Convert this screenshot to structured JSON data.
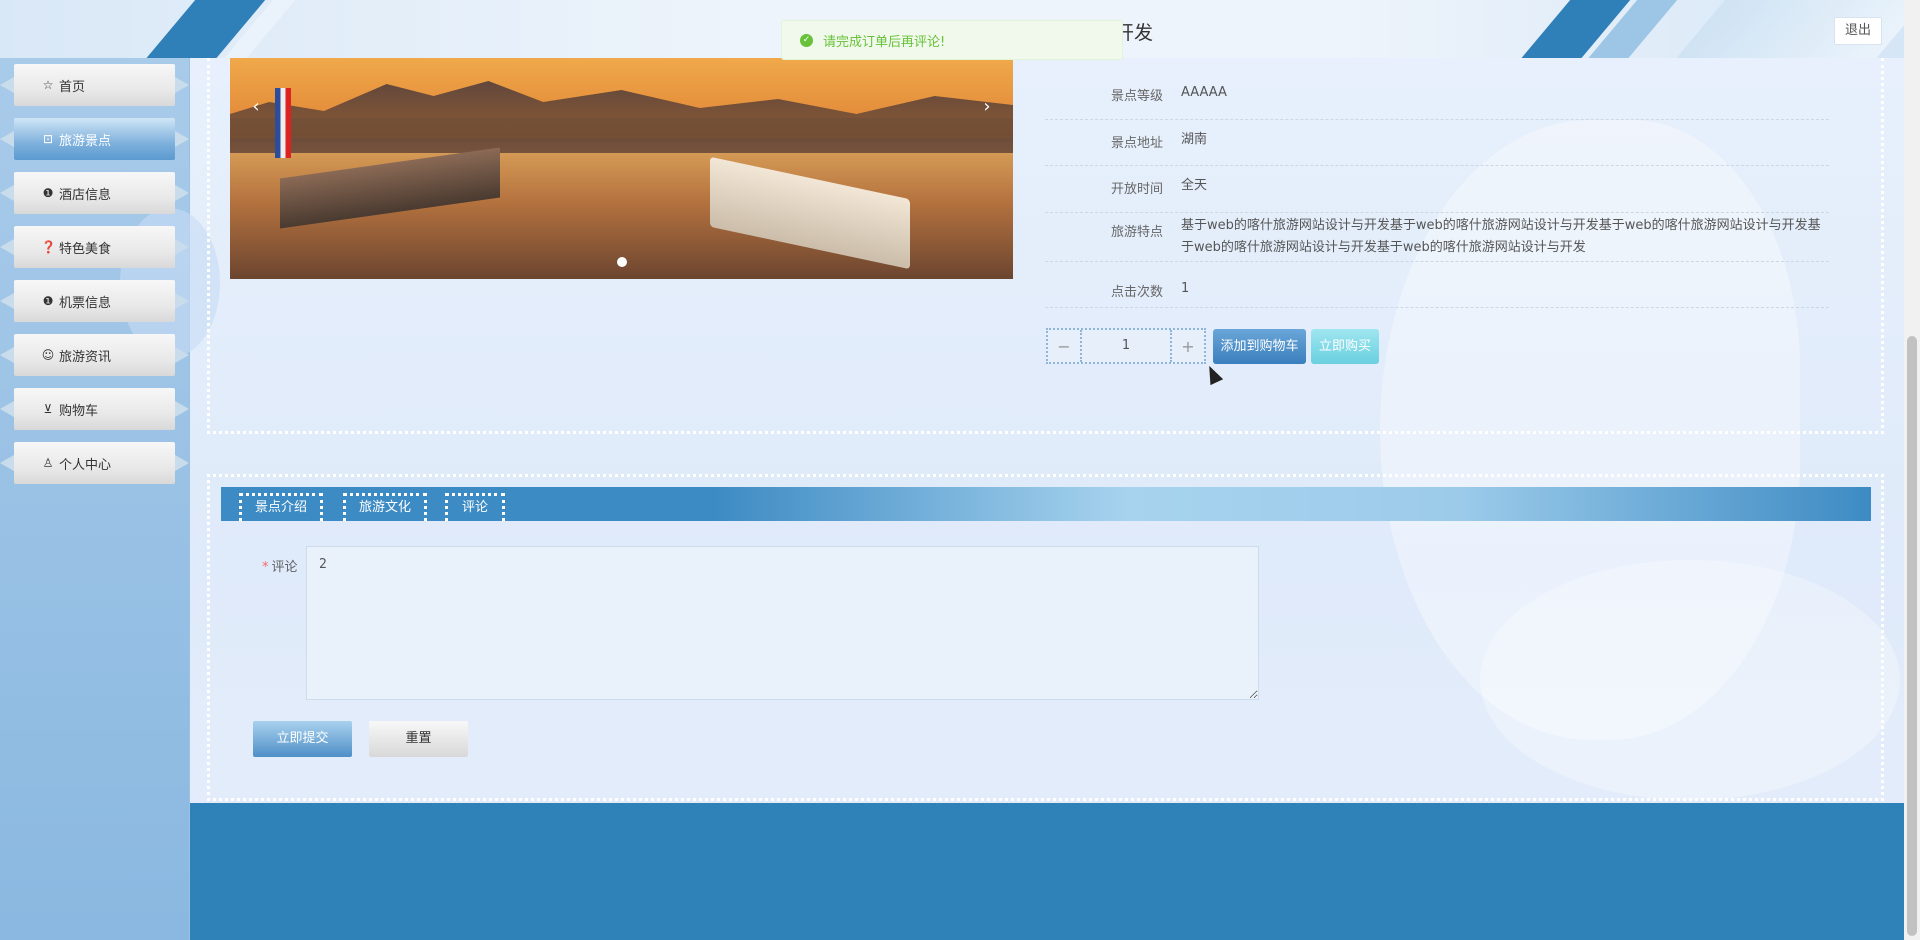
{
  "header": {
    "title": "开发",
    "logout_label": "退出"
  },
  "toast": {
    "message": "请完成订单后再评论!",
    "icon": "check-circle-icon",
    "color": "#67c23a"
  },
  "sidebar": {
    "items": [
      {
        "label": "首页",
        "icon": "star-icon",
        "active": false
      },
      {
        "label": "旅游景点",
        "icon": "bag-icon",
        "active": true
      },
      {
        "label": "酒店信息",
        "icon": "info-circle-icon",
        "active": false
      },
      {
        "label": "特色美食",
        "icon": "question-circle-icon",
        "active": false
      },
      {
        "label": "机票信息",
        "icon": "info-icon",
        "active": false
      },
      {
        "label": "旅游资讯",
        "icon": "smile-icon",
        "active": false
      },
      {
        "label": "购物车",
        "icon": "cart-icon",
        "active": false
      },
      {
        "label": "个人中心",
        "icon": "user-icon",
        "active": false
      }
    ]
  },
  "carousel": {
    "prev_label": "‹",
    "next_label": "›"
  },
  "details": [
    {
      "label": "景点等级",
      "value": "AAAAA"
    },
    {
      "label": "景点地址",
      "value": "湖南"
    },
    {
      "label": "开放时间",
      "value": "全天"
    },
    {
      "label": "旅游特点",
      "value": "基于web的喀什旅游网站设计与开发基于web的喀什旅游网站设计与开发基于web的喀什旅游网站设计与开发基于web的喀什旅游网站设计与开发基于web的喀什旅游网站设计与开发"
    },
    {
      "label": "点击次数",
      "value": "1"
    }
  ],
  "purchase": {
    "quantity": "1",
    "minus_label": "−",
    "plus_label": "+",
    "add_cart_label": "添加到购物车",
    "buy_now_label": "立即购买"
  },
  "tabs": [
    {
      "label": "景点介绍",
      "active": false
    },
    {
      "label": "旅游文化",
      "active": false
    },
    {
      "label": "评论",
      "active": true
    }
  ],
  "comment_form": {
    "label": "评论",
    "required_mark": "*",
    "value": "2",
    "submit_label": "立即提交",
    "reset_label": "重置"
  },
  "colors": {
    "primary": "#2f82b8",
    "sidebar_bg": "#a9cbea",
    "success": "#67c23a"
  }
}
